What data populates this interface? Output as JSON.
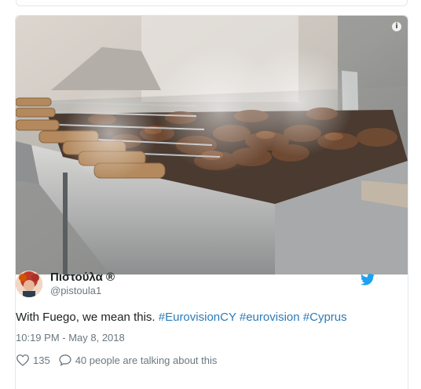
{
  "tweet": {
    "author": {
      "display_name": "Πιστούλα ®",
      "handle": "@pistoula1"
    },
    "text_plain": "With Fuego, we mean this. ",
    "hashtags": [
      "#EurovisionCY",
      "#eurovision",
      "#Cyprus"
    ],
    "timestamp": "10:19 PM - May 8, 2018",
    "likes": "135",
    "talking": "40 people are talking about this"
  },
  "icons": {
    "info": "info-icon",
    "brand": "twitter-bird-icon",
    "like": "heart-icon",
    "reply": "speech-bubble-icon"
  },
  "colors": {
    "link": "#2b7bb9",
    "brand": "#1da1f2",
    "muted": "#697882",
    "text": "#1c2022"
  }
}
